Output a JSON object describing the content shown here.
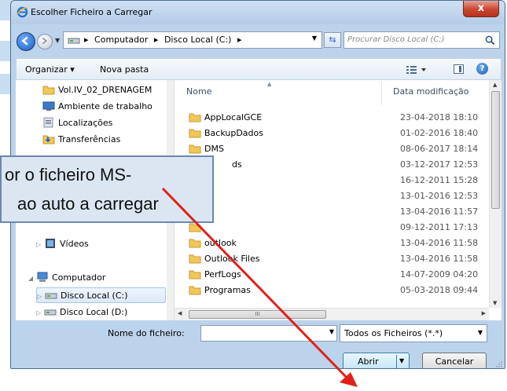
{
  "window": {
    "title": "Escolher Ficheiro a Carregar",
    "close_label": "x"
  },
  "address": {
    "crumbs": [
      "Computador",
      "Disco Local (C:)"
    ],
    "separator": "▸",
    "search_placeholder": "Procurar Disco Local (C:)"
  },
  "toolbar": {
    "organize_label": "Organizar ▾",
    "new_folder_label": "Nova pasta"
  },
  "nav": {
    "items": [
      {
        "label": "Vol.IV_02_DRENAGEM",
        "icon": "folder-icon"
      },
      {
        "label": "Ambiente de trabalho",
        "icon": "desktop-icon"
      },
      {
        "label": "Localizações",
        "icon": "places-icon"
      },
      {
        "label": "Transferências",
        "icon": "downloads-icon"
      },
      {
        "label": "Vídeos",
        "icon": "videos-icon"
      },
      {
        "label": "Computador",
        "icon": "computer-icon"
      },
      {
        "label": "Disco Local (C:)",
        "icon": "drive-icon"
      },
      {
        "label": "Disco Local (D:)",
        "icon": "drive-icon"
      }
    ]
  },
  "filelist": {
    "col_name": "Nome",
    "col_date": "Data modificação",
    "rows": [
      {
        "name": "AppLocalGCE",
        "date": "23-04-2018 18:10"
      },
      {
        "name": "BackupDados",
        "date": "01-02-2016 18:40"
      },
      {
        "name": "DMS",
        "date": "08-06-2017 18:14"
      },
      {
        "name": "ds",
        "date": "03-12-2017 12:53"
      },
      {
        "name": "",
        "date": "16-12-2011 15:28"
      },
      {
        "name": "",
        "date": "13-01-2016 12:53"
      },
      {
        "name": "",
        "date": "13-04-2016 11:57"
      },
      {
        "name": "",
        "date": "09-12-2011 17:13"
      },
      {
        "name": "outlook",
        "date": "13-04-2016 11:58"
      },
      {
        "name": "Outlook Files",
        "date": "13-04-2016 11:58"
      },
      {
        "name": "PerfLogs",
        "date": "14-07-2009 04:20"
      },
      {
        "name": "Programas",
        "date": "05-03-2018 09:44"
      }
    ],
    "hscroll_grip": "III"
  },
  "bottom": {
    "filename_label": "Nome do ficheiro:",
    "filename_value": "",
    "filter_value": "Todos os Ficheiros (*.*)",
    "open_label": "Abrir",
    "cancel_label": "Cancelar"
  },
  "callout": {
    "line1": "or o ficheiro MS-",
    "line2": "ao auto a carregar"
  },
  "colors": {
    "arrow": "#e0211b",
    "callout_border": "#6b88ad",
    "callout_bg": "#dbe6f2"
  }
}
